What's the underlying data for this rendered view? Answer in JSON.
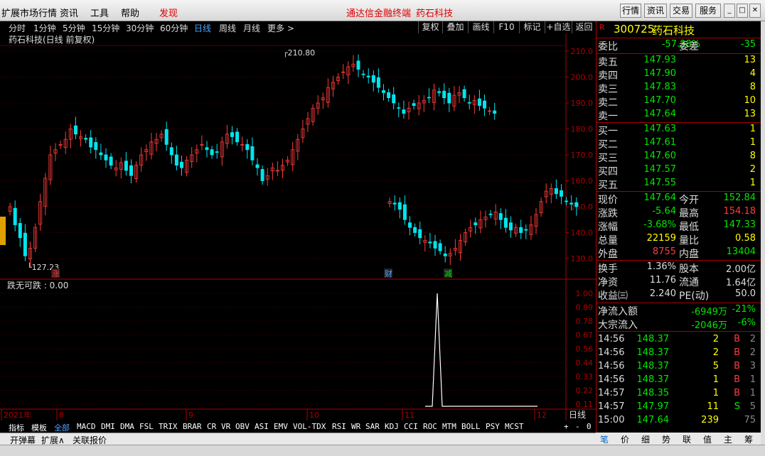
{
  "menubar": {
    "items": [
      "扩展市场行情",
      "资讯",
      "工具",
      "帮助",
      "发现"
    ],
    "center_title": "通达信金融终端",
    "center_stock": "药石科技",
    "right_buttons": [
      "行情",
      "资讯",
      "交易",
      "服务"
    ]
  },
  "timeframes": [
    "分时",
    "1分钟",
    "5分钟",
    "15分钟",
    "30分钟",
    "60分钟",
    "日线",
    "周线",
    "月线",
    "更多 >"
  ],
  "active_timeframe": "日线",
  "chart_tools": [
    "复权",
    "叠加",
    "画线",
    "F10",
    "标记",
    "+自选",
    "返回"
  ],
  "chart_title": "药石科技(日线 前复权)",
  "chart_data": {
    "type": "candlestick",
    "price_axis": {
      "min": 130,
      "max": 210,
      "ticks": [
        "210.0",
        "200.0",
        "190.0",
        "180.0",
        "170.0",
        "160.0",
        "150.0",
        "140.0",
        "130.0"
      ]
    },
    "annotations": {
      "high": "210.80",
      "low": "127.23",
      "markers": [
        "涨",
        "财",
        "减"
      ]
    },
    "month_labels": [
      "2021年",
      "8",
      "9",
      "10",
      "11",
      "12"
    ],
    "indicator": {
      "name": "跌无可跌 : 0.00",
      "ticks": [
        "1.00",
        "0.89",
        "0.78",
        "0.67",
        "0.56",
        "0.44",
        "0.33",
        "0.22",
        "0.11"
      ]
    },
    "period_label": "日线",
    "colors": {
      "up": "#ff3b3b",
      "down": "#00e5ee",
      "axis": "#b00000",
      "grid": "#500000"
    }
  },
  "indicators": [
    "指标",
    "模板",
    "全部",
    "MACD",
    "DMI",
    "DMA",
    "FSL",
    "TRIX",
    "BRAR",
    "CR",
    "VR",
    "OBV",
    "ASI",
    "EMV",
    "VOL-TDX",
    "RSI",
    "WR",
    "SAR",
    "KDJ",
    "CCI",
    "ROC",
    "MTM",
    "BOLL",
    "PSY",
    "MCST"
  ],
  "bottom_tabs": [
    "开弹幕",
    "扩展∧",
    "关联报价"
  ],
  "scroll_controls": [
    "+",
    "-",
    "0"
  ],
  "quote": {
    "code": "300725",
    "name": "药石科技",
    "weibi_label": "委比",
    "weibi": "-57.38%",
    "weicha_label": "委差",
    "weicha": "-35",
    "sells": [
      {
        "label": "卖五",
        "price": "147.93",
        "vol": "13"
      },
      {
        "label": "卖四",
        "price": "147.90",
        "vol": "4"
      },
      {
        "label": "卖三",
        "price": "147.83",
        "vol": "8"
      },
      {
        "label": "卖二",
        "price": "147.70",
        "vol": "10"
      },
      {
        "label": "卖一",
        "price": "147.64",
        "vol": "13"
      }
    ],
    "buys": [
      {
        "label": "买一",
        "price": "147.63",
        "vol": "1"
      },
      {
        "label": "买二",
        "price": "147.61",
        "vol": "1"
      },
      {
        "label": "买三",
        "price": "147.60",
        "vol": "8"
      },
      {
        "label": "买四",
        "price": "147.57",
        "vol": "2"
      },
      {
        "label": "买五",
        "price": "147.55",
        "vol": "1"
      }
    ],
    "stats": [
      {
        "l1": "现价",
        "v1": "147.64",
        "c1": "g",
        "l2": "今开",
        "v2": "152.84",
        "c2": "g"
      },
      {
        "l1": "涨跌",
        "v1": "-5.64",
        "c1": "g",
        "l2": "最高",
        "v2": "154.18",
        "c2": "r"
      },
      {
        "l1": "涨幅",
        "v1": "-3.68%",
        "c1": "g",
        "l2": "最低",
        "v2": "147.33",
        "c2": "g"
      },
      {
        "l1": "总量",
        "v1": "22159",
        "c1": "y",
        "l2": "量比",
        "v2": "0.58",
        "c2": "y"
      },
      {
        "l1": "外盘",
        "v1": "8755",
        "c1": "r",
        "l2": "内盘",
        "v2": "13404",
        "c2": "g"
      }
    ],
    "stats2": [
      {
        "l1": "换手",
        "v1": "1.36%",
        "l2": "股本",
        "v2": "2.00亿"
      },
      {
        "l1": "净资",
        "v1": "11.76",
        "l2": "流通",
        "v2": "1.64亿"
      },
      {
        "l1": "收益㈢",
        "v1": "2.240",
        "l2": "PE(动)",
        "v2": "50.0"
      }
    ],
    "flows": [
      {
        "label": "净流入额",
        "value": "-6949万",
        "pct": "-21%"
      },
      {
        "label": "大宗流入",
        "value": "-2046万",
        "pct": "-6%"
      }
    ],
    "ticks": [
      {
        "time": "14:56",
        "price": "148.37",
        "vol": "2",
        "side": "B",
        "n": "2"
      },
      {
        "time": "14:56",
        "price": "148.37",
        "vol": "2",
        "side": "B",
        "n": "2"
      },
      {
        "time": "14:56",
        "price": "148.37",
        "vol": "5",
        "side": "B",
        "n": "3"
      },
      {
        "time": "14:56",
        "price": "148.37",
        "vol": "1",
        "side": "B",
        "n": "1"
      },
      {
        "time": "14:57",
        "price": "148.35",
        "vol": "1",
        "side": "B",
        "n": "1"
      },
      {
        "time": "14:57",
        "price": "147.97",
        "vol": "11",
        "side": "S",
        "n": "5"
      },
      {
        "time": "15:00",
        "price": "147.64",
        "vol": "239",
        "side": "",
        "n": "75"
      }
    ],
    "tabs": [
      "笔",
      "价",
      "细",
      "势",
      "联",
      "值",
      "主",
      "筹"
    ]
  }
}
